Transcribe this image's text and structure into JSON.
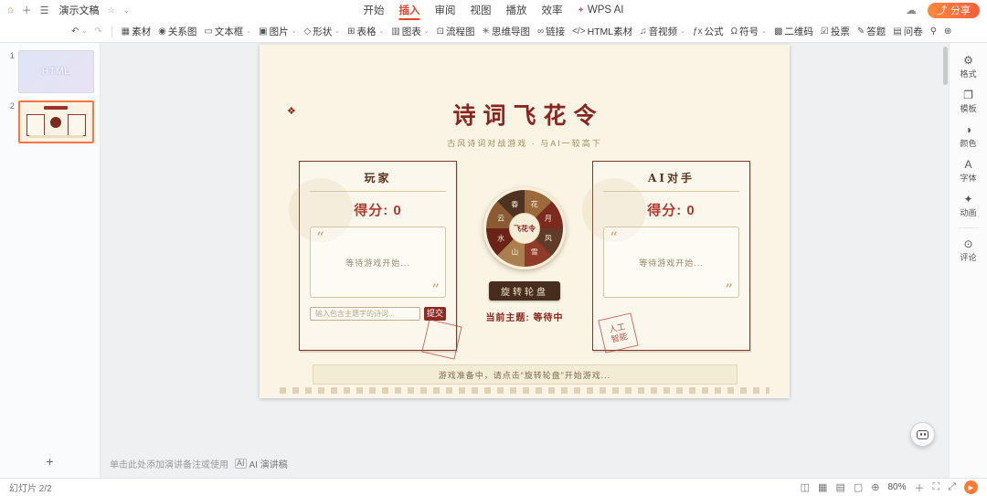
{
  "titlebar": {
    "home_icon": "⌂",
    "add_icon": "＋",
    "menu_icon": "☰",
    "doc_title": "演示文稿",
    "star_icon": "☆",
    "caret_icon": "⌄",
    "tabs": [
      {
        "label": "开始"
      },
      {
        "label": "插入"
      },
      {
        "label": "审阅"
      },
      {
        "label": "视图"
      },
      {
        "label": "播放"
      },
      {
        "label": "效率"
      },
      {
        "label": "WPS AI"
      }
    ],
    "wps_ai_icon": "✦",
    "cloud_icon": "☁",
    "share_icon": "⤴",
    "share_label": "分享"
  },
  "toolbar": {
    "undo_icon": "↶",
    "redo_icon": "↷",
    "caret": "⌄",
    "items": [
      {
        "icon": "▦",
        "label": "素材"
      },
      {
        "icon": "◉",
        "label": "关系图"
      },
      {
        "icon": "▭",
        "label": "文本框"
      },
      {
        "icon": "▣",
        "label": "图片"
      },
      {
        "icon": "◇",
        "label": "形状"
      },
      {
        "icon": "⊞",
        "label": "表格"
      },
      {
        "icon": "▥",
        "label": "图表"
      },
      {
        "icon": "⊡",
        "label": "流程图"
      },
      {
        "icon": "✳",
        "label": "思维导图"
      },
      {
        "icon": "∞",
        "label": "链接"
      },
      {
        "icon": "</>",
        "label": "HTML素材"
      },
      {
        "icon": "♫",
        "label": "音视频"
      },
      {
        "icon": "ƒx",
        "label": "公式"
      },
      {
        "icon": "Ω",
        "label": "符号"
      },
      {
        "icon": "▩",
        "label": "二维码"
      },
      {
        "icon": "☑",
        "label": "投票"
      },
      {
        "icon": "✎",
        "label": "答题"
      },
      {
        "icon": "▤",
        "label": "问卷"
      }
    ],
    "search_icon": "⚲",
    "more_icon": "⊕"
  },
  "thumbnails": {
    "slides": [
      {
        "number": "1",
        "label": "HTML"
      },
      {
        "number": "2"
      }
    ],
    "add_label": "+"
  },
  "slide": {
    "title": "诗词飞花令",
    "subtitle": "古风诗词对战游戏 · 与AI一较高下",
    "ornament_icon": "❖",
    "quote_open": "“",
    "quote_close": "”",
    "player_panel": {
      "title": "玩家",
      "score": "得分: 0",
      "waiting": "等待游戏开始...",
      "input_placeholder": "输入包含主题字的诗词...",
      "submit": "提交"
    },
    "wheel": {
      "center": "飞花令",
      "segments": [
        "花",
        "月",
        "风",
        "雪",
        "山",
        "水",
        "云",
        "春"
      ],
      "colors": [
        "#9b6a3c",
        "#7c2a1e",
        "#5f3b28",
        "#8e3b2a",
        "#a97f4f",
        "#6b2318",
        "#8a5a32",
        "#4f3322"
      ],
      "spin_button": "旋转轮盘",
      "topic": "当前主题: 等待中"
    },
    "ai_panel": {
      "title": "AI对手",
      "score": "得分: 0",
      "waiting": "等待游戏开始...",
      "seal": "人工智能"
    },
    "footer": "游戏准备中，请点击“旋转轮盘”开始游戏..."
  },
  "right_sidebar": {
    "items": [
      {
        "icon": "⚙",
        "label": "格式"
      },
      {
        "icon": "❐",
        "label": "模板"
      },
      {
        "icon": "◑",
        "label": "颜色"
      },
      {
        "icon": "A",
        "label": "字体"
      },
      {
        "icon": "✦",
        "label": "动画"
      },
      {
        "icon": "⊙",
        "label": "评论"
      }
    ]
  },
  "notes_hint": {
    "text": "单击此处添加演讲备注或使用",
    "ai_icon": "AI",
    "ai_label": "AI 演讲稿"
  },
  "statusbar": {
    "slide_counter": "幻灯片 2/2",
    "view_icons": [
      "◫",
      "▦",
      "▤",
      "▢",
      "⊕"
    ],
    "zoom": "80%",
    "zoom_in_icon": "＋",
    "fit_icon": "⛶",
    "expand_icon": "⤢",
    "play_icon": "▶"
  },
  "colors": {
    "accent_orange": "#ff6e3e",
    "active_tab_red": "#e8442e",
    "slide_cream": "#f9f4e3",
    "deep_red": "#8b2520",
    "score_red": "#b13a2e"
  }
}
